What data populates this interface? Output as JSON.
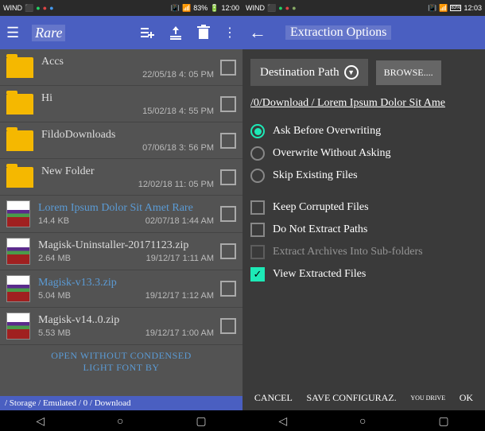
{
  "status": {
    "carrier": "WIND",
    "battery_pct": "83%",
    "battery_pct2": "83%",
    "time1": "12:00",
    "time2": "12:03"
  },
  "left": {
    "title": "Rare",
    "files": [
      {
        "type": "folder",
        "name": "Accs",
        "date": "22/05/18 4: 05 PM"
      },
      {
        "type": "folder",
        "name": "Hi",
        "date": "15/02/18 4: 55 PM"
      },
      {
        "type": "folder",
        "name": "FildoDownloads",
        "date": "07/06/18 3: 56 PM"
      },
      {
        "type": "folder",
        "name": "New Folder",
        "date": "12/02/18 11: 05 PM"
      },
      {
        "type": "rar",
        "name": "Lorem Ipsum Dolor Sit Amet Rare",
        "size": "14.4 KB",
        "date": "02/07/18 1:44 AM"
      },
      {
        "type": "rar",
        "name": "Magisk-Uninstaller-20171123.zip",
        "size": "2.64 MB",
        "date": "19/12/17 1:11 AM"
      },
      {
        "type": "rar",
        "name": "Magisk-v13.3.zip",
        "size": "5.04 MB",
        "date": "19/12/17 1:12 AM"
      },
      {
        "type": "rar",
        "name": "Magisk-v14..0.zip",
        "size": "5.53 MB",
        "date": "19/12/17 1:00 AM"
      }
    ],
    "open_text_1": "OPEN WITHOUT CONDENSED",
    "open_text_2": "LIGHT FONT BY",
    "path": "/ Storage / Emulated / 0 / Download"
  },
  "right": {
    "title": "Extraction Options",
    "dest_label": "Destination Path",
    "browse_label": "BROWSE....",
    "path": "/0/Download / Lorem Ipsum Dolor Sit Ame",
    "radios": {
      "ask": "Ask Before Overwriting",
      "overwrite": "Overwrite Without Asking",
      "skip": "Skip Existing Files"
    },
    "checks": {
      "keep": "Keep Corrupted Files",
      "nopaths": "Do Not Extract Paths",
      "subfolders": "Extract Archives Into Sub-folders",
      "view": "View Extracted Files"
    },
    "actions": {
      "cancel": "CANCEL",
      "save": "SAVE CONFIGURAZ.",
      "drive": "YOU DRIVE",
      "ok": "OK"
    }
  },
  "nav": {
    "back": "◁",
    "home": "○",
    "recent": "▢"
  }
}
